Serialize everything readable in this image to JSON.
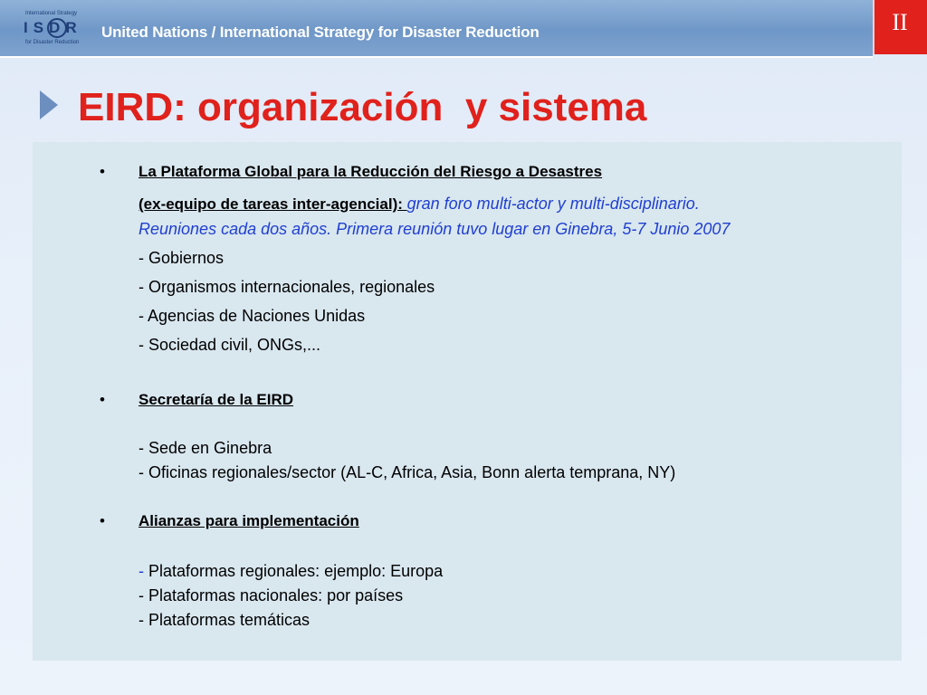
{
  "header": {
    "logo_small_top": "International Strategy",
    "logo_letters": "ISDR",
    "logo_small_bottom": "for Disaster Reduction",
    "title": "United Nations / International Strategy for Disaster Reduction",
    "slide_number": "II"
  },
  "slide": {
    "title": "EIRD: organización  y sistema"
  },
  "sections": [
    {
      "bullet": "•",
      "heading": "La Plataforma Global para la Reducción del Riesgo a Desastres",
      "subheading": "(ex-equipo de tareas inter-agencial): ",
      "description_1": "gran foro multi-actor y multi-disciplinario.",
      "description_2": "Reuniones cada dos años. Primera reunión tuvo lugar en Ginebra, 5-7 Junio 2007",
      "items": [
        "- Gobiernos",
        "- Organismos internacionales, regionales",
        "- Agencias de Naciones Unidas",
        "- Sociedad civil, ONGs,..."
      ]
    },
    {
      "bullet": "•",
      "heading": "Secretaría de la EIRD",
      "items": [
        "- Sede en Ginebra",
        "- Oficinas regionales/sector (AL-C, Africa, Asia, Bonn alerta temprana, NY)"
      ]
    },
    {
      "bullet": "•",
      "heading": "Alianzas para implementación",
      "first_item_dash": "- ",
      "first_item_text": "Plataformas regionales: ejemplo: Europa",
      "items": [
        "- Plataformas nacionales: por países",
        "- Plataformas temáticas"
      ]
    }
  ],
  "colors": {
    "title_red": "#e0211c",
    "header_blue": "#6f97c7",
    "content_bg": "#d9e7ef",
    "italic_blue": "#1f3fd0"
  }
}
